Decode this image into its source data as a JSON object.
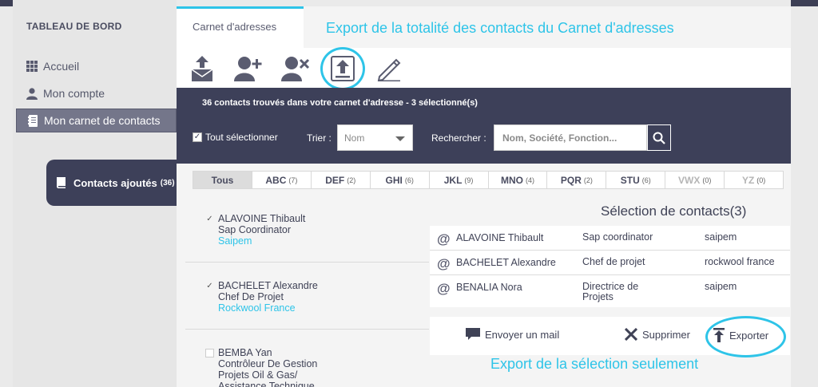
{
  "sidebar": {
    "title": "TABLEAU DE BORD",
    "items": [
      {
        "label": "Accueil"
      },
      {
        "label": "Mon compte"
      },
      {
        "label": "Mon carnet de contacts"
      }
    ],
    "contacts_added": {
      "label": "Contacts ajoutés",
      "count": "(36)"
    }
  },
  "tabs": {
    "active": "Carnet d'adresses"
  },
  "annotations": {
    "top": "Export de la totalité des contacts du Carnet d'adresses",
    "bottom": "Export de la sélection seulement"
  },
  "toolbar": {
    "icons": [
      "mail-export-icon",
      "add-contact-icon",
      "remove-contact-icon",
      "export-all-icon",
      "edit-icon"
    ]
  },
  "header": {
    "count_text": "36 contacts trouvés dans votre carnet d'adresse - 3 sélectionné(s)",
    "select_all": "Tout sélectionner",
    "sort_label": "Trier :",
    "sort_value": "Nom",
    "search_label": "Rechercher :",
    "search_placeholder": "Nom, Société, Fonction..."
  },
  "alpha_tabs": [
    {
      "label": "Tous",
      "count": ""
    },
    {
      "label": "ABC",
      "count": "(7)"
    },
    {
      "label": "DEF",
      "count": "(2)"
    },
    {
      "label": "GHI",
      "count": "(6)"
    },
    {
      "label": "JKL",
      "count": "(9)"
    },
    {
      "label": "MNO",
      "count": "(4)"
    },
    {
      "label": "PQR",
      "count": "(2)"
    },
    {
      "label": "STU",
      "count": "(6)"
    },
    {
      "label": "VWX",
      "count": "(0)"
    },
    {
      "label": "YZ",
      "count": "(0)"
    }
  ],
  "contacts": [
    {
      "name": "ALAVOINE Thibault",
      "title": "Sap Coordinator",
      "company": "Saipem",
      "checked": true
    },
    {
      "name": "BACHELET Alexandre",
      "title": "Chef De Projet",
      "company": "Rockwool France",
      "checked": true
    },
    {
      "name": "BEMBA Yan",
      "title_lines": [
        "Contrôleur De Gestion",
        "Projets Oil & Gas/",
        "Assistance Technique"
      ],
      "checked": false
    }
  ],
  "selection": {
    "title": "Sélection de contacts(3)",
    "rows": [
      {
        "name": "ALAVOINE Thibault",
        "function": "Sap coordinator",
        "org": "saipem"
      },
      {
        "name": "BACHELET Alexandre",
        "function": "Chef de projet",
        "org": "rockwool france"
      },
      {
        "name": "BENALIA Nora",
        "function": "Directrice de Projets",
        "org": "saipem"
      }
    ]
  },
  "actions": {
    "mail": "Envoyer un mail",
    "delete": "Supprimer",
    "export": "Exporter"
  },
  "colors": {
    "accent": "#2ec4e8",
    "dark": "#3d4059"
  }
}
